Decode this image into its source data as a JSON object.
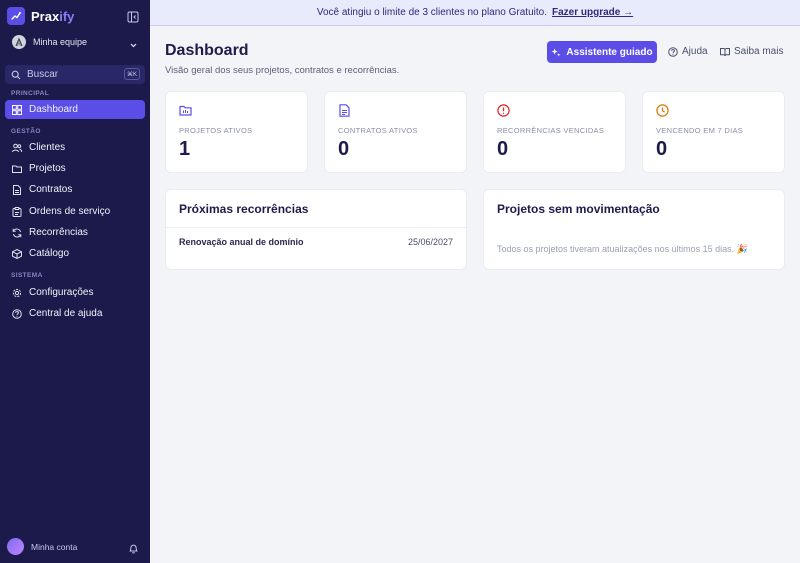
{
  "app": {
    "name_main": "Prax",
    "name_accent": "ify"
  },
  "team": {
    "name": "Minha equipe"
  },
  "search": {
    "label": "Buscar",
    "shortcut": "⌘K"
  },
  "sidebar": {
    "sections": [
      {
        "label": "PRINCIPAL"
      },
      {
        "label": "GESTÃO"
      },
      {
        "label": "SISTEMA"
      }
    ],
    "items": [
      {
        "label": "Dashboard",
        "icon": "grid-icon",
        "active": true
      },
      {
        "label": "Clientes",
        "icon": "users-icon"
      },
      {
        "label": "Projetos",
        "icon": "folder-icon"
      },
      {
        "label": "Contratos",
        "icon": "file-icon"
      },
      {
        "label": "Ordens de serviço",
        "icon": "clipboard-icon"
      },
      {
        "label": "Recorrências",
        "icon": "refresh-icon"
      },
      {
        "label": "Catálogo",
        "icon": "box-icon"
      },
      {
        "label": "Configurações",
        "icon": "gear-icon"
      },
      {
        "label": "Central de ajuda",
        "icon": "help-icon"
      }
    ]
  },
  "account": {
    "label": "Minha conta"
  },
  "banner": {
    "text": "Você atingiu o limite de 3 clientes no plano Gratuito.",
    "link": "Fazer upgrade →"
  },
  "header": {
    "title": "Dashboard",
    "subtitle": "Visão geral dos seus projetos, contratos e recorrências.",
    "guide_button": "Assistente guiado",
    "help_link": "Ajuda",
    "learn_link": "Saiba mais"
  },
  "colors": {
    "brand": "#5b4ee6",
    "sidebar": "#1c1a4a",
    "danger": "#dc2626",
    "warning": "#d97706"
  },
  "stats": [
    {
      "label": "PROJETOS ATIVOS",
      "value": "1",
      "icon": "folder-icon"
    },
    {
      "label": "CONTRATOS ATIVOS",
      "value": "0",
      "icon": "file-icon"
    },
    {
      "label": "RECORRÊNCIAS VENCIDAS",
      "value": "0",
      "icon": "alert-icon"
    },
    {
      "label": "VENCENDO EM 7 DIAS",
      "value": "0",
      "icon": "clock-icon"
    }
  ],
  "recurrences": {
    "title": "Próximas recorrências",
    "rows": [
      {
        "name": "Renovação anual de domínio",
        "date": "25/06/2027"
      }
    ]
  },
  "stale": {
    "title": "Projetos sem movimentação",
    "empty": "Todos os projetos tiveram atualizações nos últimos 15 dias. 🎉"
  }
}
